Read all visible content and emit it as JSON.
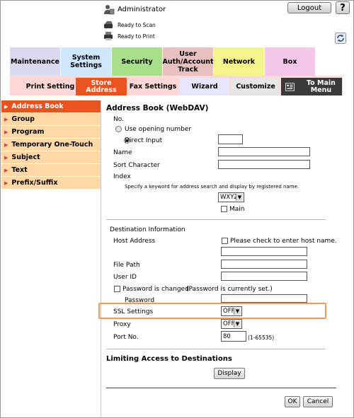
{
  "header": {
    "user": "Administrator",
    "logout_label": "Logout",
    "help_label": "?",
    "scan_status": "Ready to Scan",
    "print_status": "Ready to Print"
  },
  "categories": [
    {
      "label": "Maintenance",
      "color": "#d9d9f2"
    },
    {
      "label": "System Settings",
      "color": "#cfe6ff"
    },
    {
      "label": "Security",
      "color": "#a8e08a"
    },
    {
      "label": "User Auth/Account Track",
      "color": "#e8c0c0"
    },
    {
      "label": "Network",
      "color": "#f4f48c"
    },
    {
      "label": "Box",
      "color": "#f4c6e8"
    }
  ],
  "subtabs": {
    "print_setting": "Print Setting",
    "store_address": "Store Address",
    "fax_settings": "Fax Settings",
    "wizard": "Wizard",
    "customize": "Customize",
    "to_main_menu": "To Main Menu"
  },
  "sidebar": [
    {
      "label": "Address Book",
      "active": true
    },
    {
      "label": "Group",
      "active": false
    },
    {
      "label": "Program",
      "active": false
    },
    {
      "label": "Temporary One-Touch",
      "active": false
    },
    {
      "label": "Subject",
      "active": false
    },
    {
      "label": "Text",
      "active": false
    },
    {
      "label": "Prefix/Suffix",
      "active": false
    }
  ],
  "form": {
    "title": "Address Book (WebDAV)",
    "no_label": "No.",
    "use_opening_number": "Use opening number",
    "direct_input": "Direct Input",
    "direct_input_value": "",
    "name_label": "Name",
    "sort_character_label": "Sort Character",
    "index_label": "Index",
    "index_hint": "Specify a keyword for address search and display by registered name.",
    "index_value": "WXYZ",
    "main_label": "Main",
    "destination_info_label": "Destination Information",
    "host_address_label": "Host Address",
    "host_name_check_label": "Please check to enter host name.",
    "file_path_label": "File Path",
    "user_id_label": "User ID",
    "password_changed_label": "Password is changed.",
    "password_current_note": "(Password is currently set.)",
    "password_label": "Password",
    "ssl_settings_label": "SSL Settings",
    "ssl_value": "OFF",
    "proxy_label": "Proxy",
    "proxy_value": "OFF",
    "port_label": "Port No.",
    "port_value": "80",
    "port_range": "(1-65535)",
    "limiting_title": "Limiting Access to Destinations",
    "display_button": "Display",
    "ok_button": "OK",
    "cancel_button": "Cancel"
  },
  "colors": {
    "accent": "#e8531f",
    "sidebar_bg": "#ffd8a6",
    "subbar_bg": "#ffd7d7",
    "highlight": "#f39a5b"
  }
}
